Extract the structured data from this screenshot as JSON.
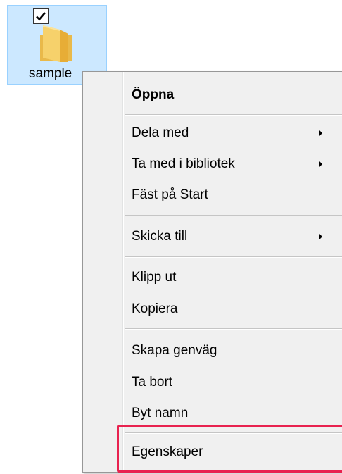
{
  "desktop_icon": {
    "label": "sample",
    "checked": true,
    "selection_color": "#cce8ff",
    "folder_color": "#f6d16b"
  },
  "context_menu": {
    "items": [
      {
        "label": "Öppna",
        "bold": true,
        "submenu": false
      },
      {
        "label": "Dela med",
        "bold": false,
        "submenu": true
      },
      {
        "label": "Ta med i bibliotek",
        "bold": false,
        "submenu": true
      },
      {
        "label": "Fäst på Start",
        "bold": false,
        "submenu": false
      },
      {
        "label": "Skicka till",
        "bold": false,
        "submenu": true
      },
      {
        "label": "Klipp ut",
        "bold": false,
        "submenu": false
      },
      {
        "label": "Kopiera",
        "bold": false,
        "submenu": false
      },
      {
        "label": "Skapa genväg",
        "bold": false,
        "submenu": false
      },
      {
        "label": "Ta bort",
        "bold": false,
        "submenu": false
      },
      {
        "label": "Byt namn",
        "bold": false,
        "submenu": false
      },
      {
        "label": "Egenskaper",
        "bold": false,
        "submenu": false
      }
    ],
    "highlighted_item": "Egenskaper",
    "highlight_color": "#e8224f",
    "background": "#f0f0f0"
  }
}
